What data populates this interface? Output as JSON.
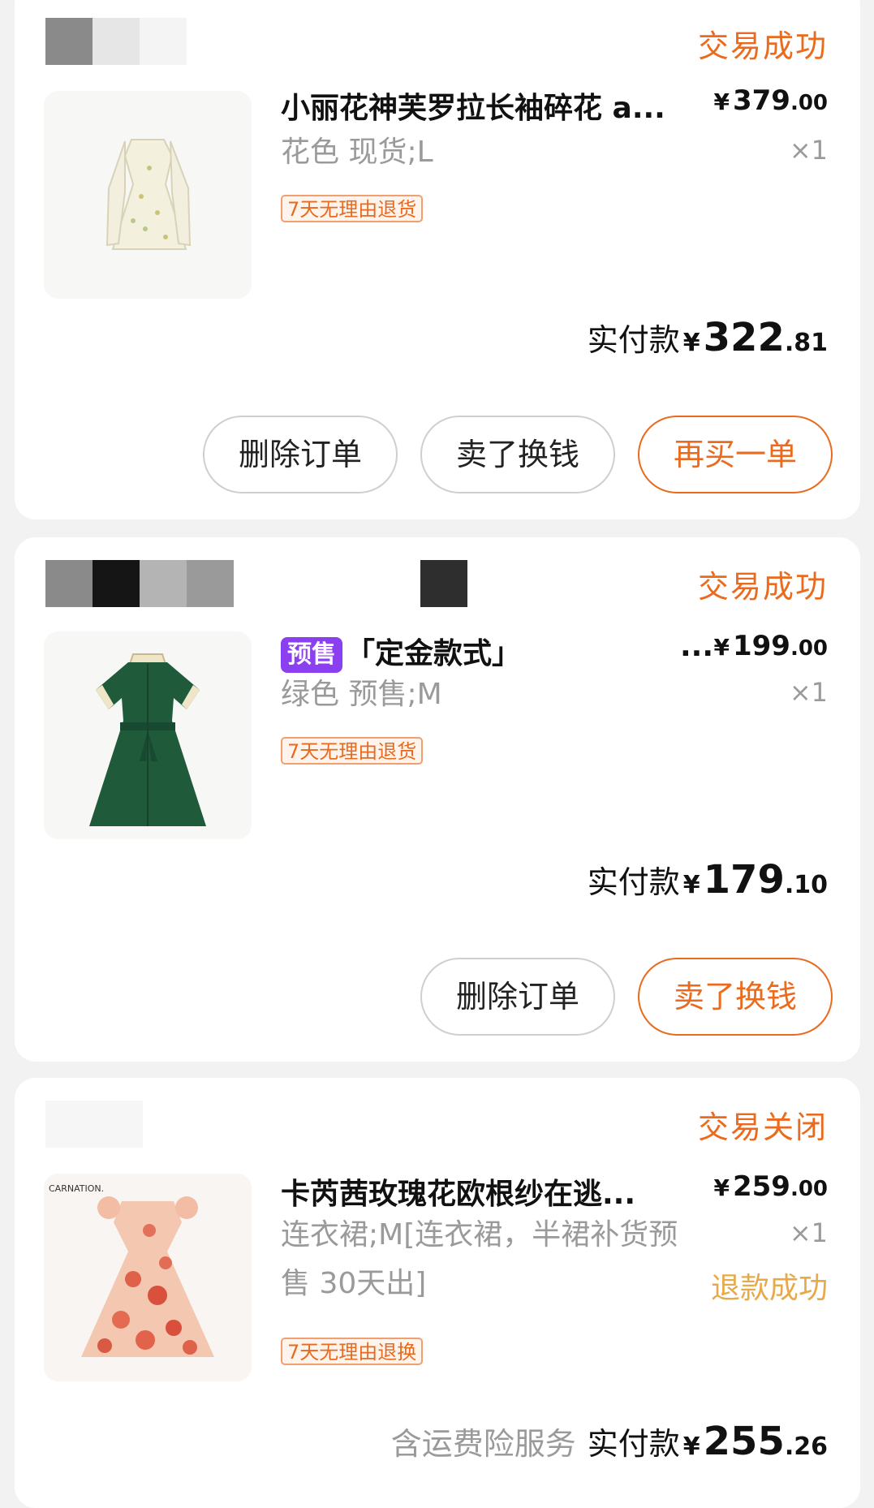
{
  "colors": {
    "accent": "#ea6a1e",
    "refund": "#e7a94a",
    "presale": "#8a3ff0"
  },
  "orders": [
    {
      "status": "交易成功",
      "title": "小丽花神芙罗拉长袖碎花 a...",
      "price_int": "379",
      "price_dec": ".00",
      "spec": "花色 现货;L",
      "qty": "×1",
      "tag": "7天无理由退货",
      "paid_label": "实付款",
      "paid_int": "322",
      "paid_dec": ".81",
      "buttons": [
        "删除订单",
        "卖了换钱",
        "再买一单"
      ]
    },
    {
      "status": "交易成功",
      "presale_badge": "预售",
      "title": "「定金款式」",
      "title_ellipsis": "...",
      "price_int": "199",
      "price_dec": ".00",
      "spec": "绿色 预售;M",
      "qty": "×1",
      "tag": "7天无理由退货",
      "paid_label": "实付款",
      "paid_int": "179",
      "paid_dec": ".10",
      "buttons": [
        "删除订单",
        "卖了换钱"
      ]
    },
    {
      "status": "交易关闭",
      "title": "卡芮茜玫瑰花欧根纱在逃...",
      "price_int": "259",
      "price_dec": ".00",
      "spec": "连衣裙;M[连衣裙，半裙补货预售 30天出]",
      "qty": "×1",
      "refund_status": "退款成功",
      "tag": "7天无理由退换",
      "extra_service": "含运费险服务",
      "paid_label": "实付款",
      "paid_int": "255",
      "paid_dec": ".26",
      "brand_text": "CARNATION."
    }
  ],
  "currency": "¥"
}
